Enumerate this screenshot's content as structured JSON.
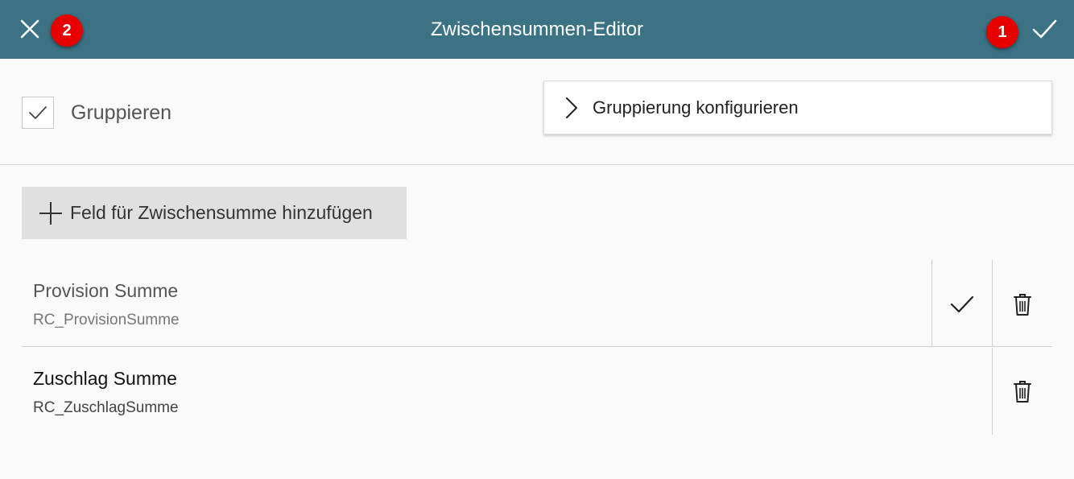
{
  "header": {
    "title": "Zwischensummen-Editor",
    "badge_close": "2",
    "badge_confirm": "1",
    "color": "#3b7284"
  },
  "grouping": {
    "checked": true,
    "label": "Gruppieren",
    "config_label": "Gruppierung konfigurieren"
  },
  "add_button": {
    "label": "Feld für Zwischensumme hinzufügen"
  },
  "rows": [
    {
      "name": "Provision Summe",
      "code": "RC_ProvisionSumme",
      "confirmed": true
    },
    {
      "name": "Zuschlag Summe",
      "code": "RC_ZuschlagSumme",
      "confirmed": false
    }
  ],
  "icons": {
    "close": "close-icon",
    "confirm": "check-icon",
    "expand": "chevron-right-icon",
    "add": "plus-icon",
    "delete": "trash-icon"
  }
}
